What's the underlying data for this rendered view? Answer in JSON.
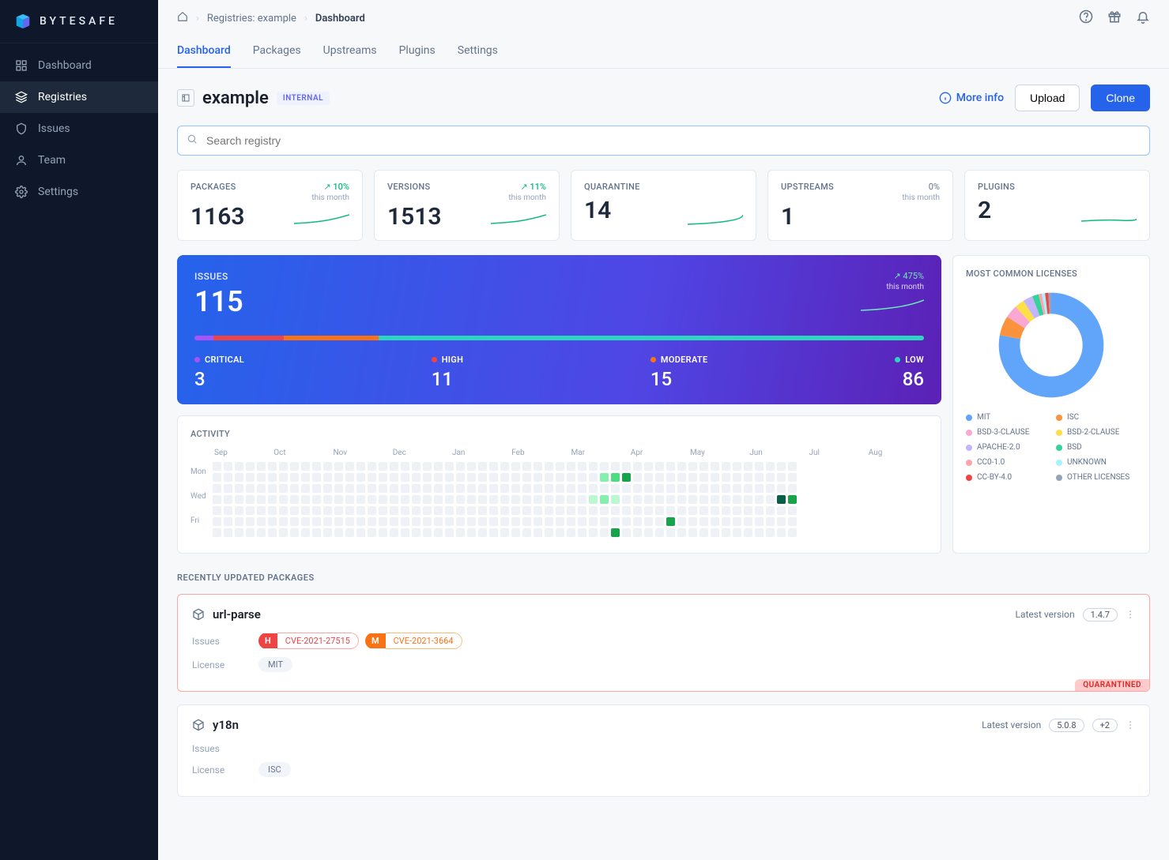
{
  "brand": "BYTESAFE",
  "sidebar": {
    "items": [
      {
        "label": "Dashboard"
      },
      {
        "label": "Registries"
      },
      {
        "label": "Issues"
      },
      {
        "label": "Team"
      },
      {
        "label": "Settings"
      }
    ]
  },
  "breadcrumb": {
    "registries": "Registries: example",
    "current": "Dashboard"
  },
  "tabs": [
    "Dashboard",
    "Packages",
    "Upstreams",
    "Plugins",
    "Settings"
  ],
  "header": {
    "title": "example",
    "badge": "INTERNAL",
    "more_info": "More info",
    "upload": "Upload",
    "clone": "Clone"
  },
  "search": {
    "placeholder": "Search registry"
  },
  "stats": {
    "packages": {
      "label": "PACKAGES",
      "value": "1163",
      "trend": "10%",
      "period": "this month"
    },
    "versions": {
      "label": "VERSIONS",
      "value": "1513",
      "trend": "11%",
      "period": "this month"
    },
    "quarantine": {
      "label": "QUARANTINE",
      "value": "14"
    },
    "upstreams": {
      "label": "UPSTREAMS",
      "value": "1",
      "trend": "0%",
      "period": "this month"
    },
    "plugins": {
      "label": "PLUGINS",
      "value": "2"
    }
  },
  "issues": {
    "label": "ISSUES",
    "value": "115",
    "trend": "475%",
    "period": "this month",
    "severities": [
      {
        "label": "CRITICAL",
        "count": "3",
        "color": "#a855f7"
      },
      {
        "label": "HIGH",
        "count": "11",
        "color": "#ef4444"
      },
      {
        "label": "MODERATE",
        "count": "15",
        "color": "#f97316"
      },
      {
        "label": "LOW",
        "count": "86",
        "color": "#2dd4bf"
      }
    ]
  },
  "licenses": {
    "label": "MOST COMMON LICENSES",
    "items": [
      {
        "name": "MIT",
        "color": "#60a5fa"
      },
      {
        "name": "ISC",
        "color": "#fb923c"
      },
      {
        "name": "BSD-3-CLAUSE",
        "color": "#f9a8d4"
      },
      {
        "name": "BSD-2-CLAUSE",
        "color": "#fde047"
      },
      {
        "name": "APACHE-2.0",
        "color": "#c4b5fd"
      },
      {
        "name": "BSD",
        "color": "#34d399"
      },
      {
        "name": "CC0-1.0",
        "color": "#fda4af"
      },
      {
        "name": "UNKNOWN",
        "color": "#a5f3fc"
      },
      {
        "name": "CC-BY-4.0",
        "color": "#ef4444"
      },
      {
        "name": "OTHER LICENSES",
        "color": "#94a3b8"
      }
    ]
  },
  "activity": {
    "label": "ACTIVITY",
    "months": [
      "Sep",
      "Oct",
      "Nov",
      "Dec",
      "Jan",
      "Feb",
      "Mar",
      "Apr",
      "May",
      "Jun",
      "Jul",
      "Aug"
    ],
    "days": [
      "Mon",
      "Wed",
      "Fri"
    ]
  },
  "recent": {
    "title": "RECENTLY UPDATED PACKAGES",
    "packages": [
      {
        "name": "url-parse",
        "latest_label": "Latest version",
        "version": "1.4.7",
        "issues_label": "Issues",
        "license_label": "License",
        "cves": [
          {
            "level": "H",
            "id": "CVE-2021-27515",
            "bg": "#ef4444",
            "border": "#fca5a5",
            "text": "#ef4444"
          },
          {
            "level": "M",
            "id": "CVE-2021-3664",
            "bg": "#f97316",
            "border": "#fdba74",
            "text": "#f97316"
          }
        ],
        "license": "MIT",
        "quarantined": "QUARANTINED"
      },
      {
        "name": "y18n",
        "latest_label": "Latest version",
        "version": "5.0.8",
        "extra_versions": "+2",
        "issues_label": "Issues",
        "license_label": "License",
        "license": "ISC"
      }
    ]
  },
  "chart_data": {
    "type": "pie",
    "title": "Most Common Licenses",
    "series": [
      {
        "name": "MIT",
        "value": 78,
        "color": "#60a5fa"
      },
      {
        "name": "ISC",
        "value": 6,
        "color": "#fb923c"
      },
      {
        "name": "BSD-3-CLAUSE",
        "value": 4,
        "color": "#f9a8d4"
      },
      {
        "name": "BSD-2-CLAUSE",
        "value": 3,
        "color": "#fde047"
      },
      {
        "name": "APACHE-2.0",
        "value": 3,
        "color": "#c4b5fd"
      },
      {
        "name": "BSD",
        "value": 2,
        "color": "#34d399"
      },
      {
        "name": "CC0-1.0",
        "value": 1,
        "color": "#fda4af"
      },
      {
        "name": "UNKNOWN",
        "value": 1,
        "color": "#a5f3fc"
      },
      {
        "name": "CC-BY-4.0",
        "value": 1,
        "color": "#ef4444"
      },
      {
        "name": "OTHER LICENSES",
        "value": 1,
        "color": "#94a3b8"
      }
    ]
  }
}
